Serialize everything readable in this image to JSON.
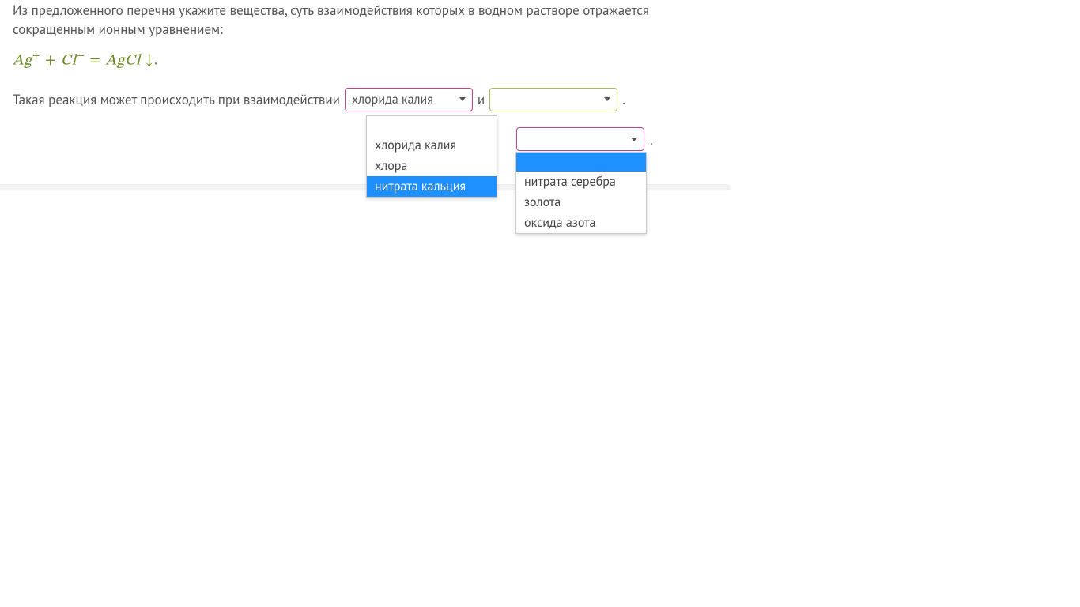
{
  "prompt": "Из предложенного перечня укажите вещества, суть взаимодействия которых  в водном растворе отражается сокращенным ионным уравнением:",
  "equation": {
    "lhs1_base": "Ag",
    "lhs1_sup": "+",
    "plus": " + ",
    "lhs2_base": "Cl",
    "lhs2_sup": "−",
    "eq": "  =  ",
    "rhs": "AgCl ",
    "arrow": "↓",
    "period": "."
  },
  "answer": {
    "lead": "Такая реакция может происходить при взаимодействии",
    "and": "и",
    "period": "."
  },
  "select1": {
    "value": "хлорида калия",
    "options": [
      "хлорида калия",
      "хлора",
      "нитрата кальция"
    ],
    "highlighted_index": 2
  },
  "select2": {
    "value": "",
    "options": [
      "нитрата серебра",
      "золота",
      "оксида азота"
    ],
    "highlighted_index": -1
  }
}
